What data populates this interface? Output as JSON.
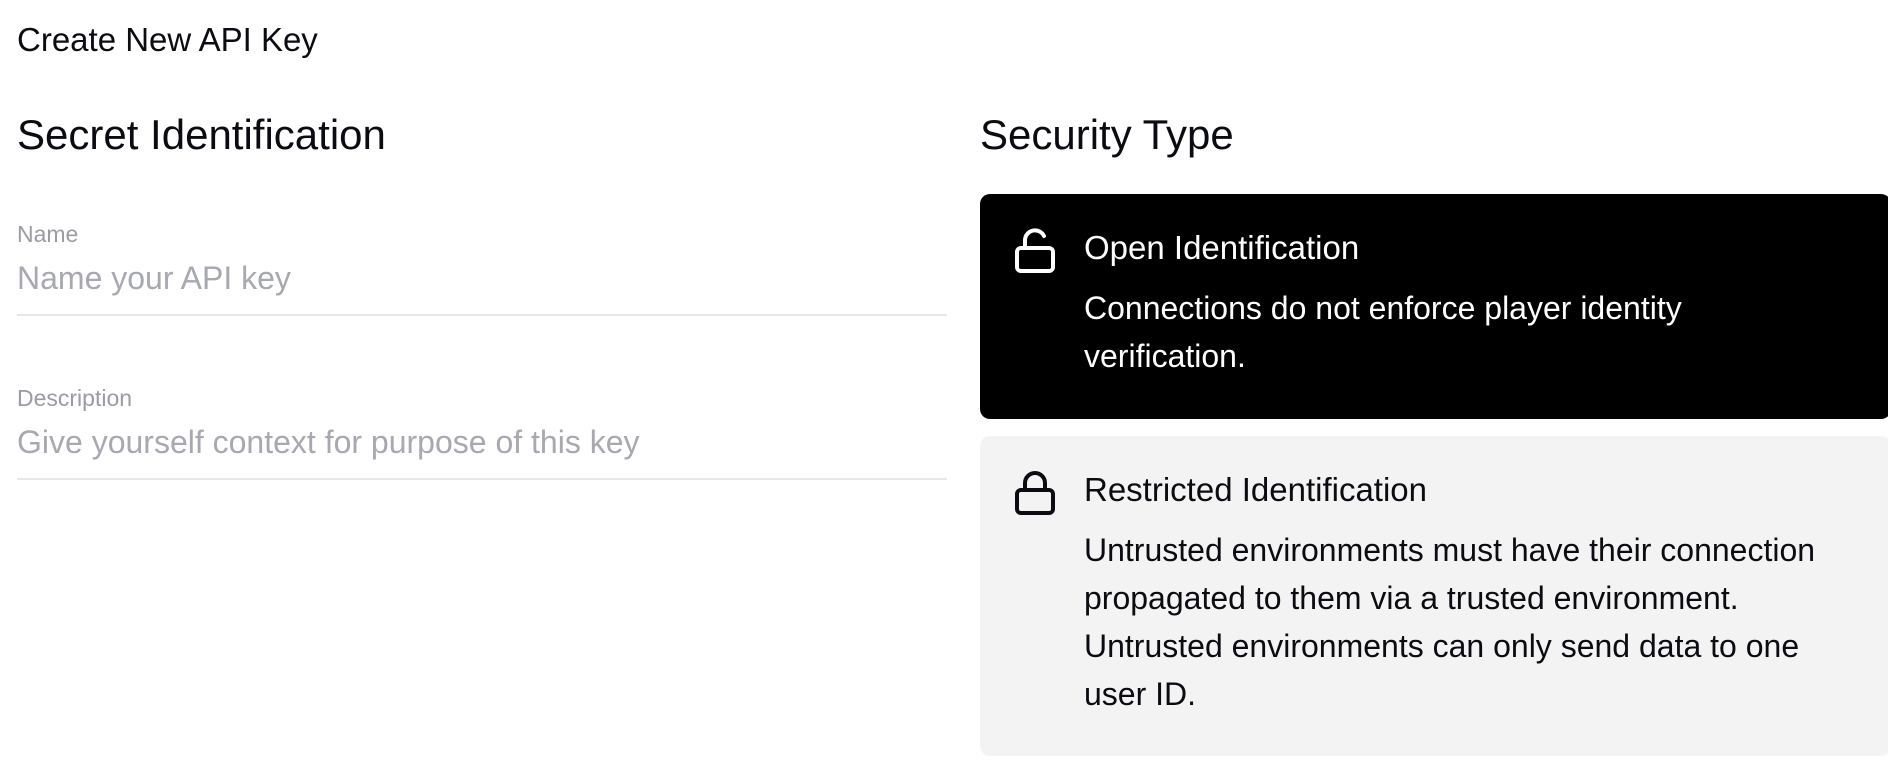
{
  "page": {
    "title": "Create New API Key"
  },
  "secret_identification": {
    "heading": "Secret Identification",
    "name_field": {
      "label": "Name",
      "value": "",
      "placeholder": "Name your API key"
    },
    "description_field": {
      "label": "Description",
      "value": "",
      "placeholder": "Give yourself context for purpose of this key"
    }
  },
  "security_type": {
    "heading": "Security Type",
    "options": [
      {
        "title": "Open Identification",
        "description": "Connections do not enforce player identity verification.",
        "icon": "unlock-icon",
        "selected": true
      },
      {
        "title": "Restricted Identification",
        "description": "Untrusted environments must have their connection propagated to them via a trusted environment. Untrusted environments can only send data to one user ID.",
        "icon": "lock-icon",
        "selected": false
      }
    ]
  },
  "colors": {
    "selected_bg": "#000000",
    "unselected_bg": "#f3f3f3",
    "label_gray": "#9a9ba3",
    "divider": "#e6e7ea"
  }
}
